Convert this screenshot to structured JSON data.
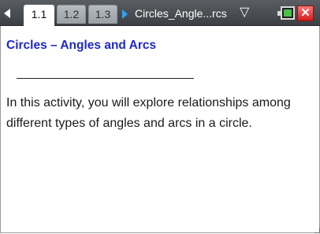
{
  "toolbar": {
    "tabs": [
      {
        "label": "1.1",
        "active": true
      },
      {
        "label": "1.2",
        "active": false
      },
      {
        "label": "1.3",
        "active": false
      }
    ],
    "document_title": "Circles_Angle...rcs",
    "chevron_glyph": "▽",
    "close_glyph": "✕",
    "icons": [
      "left-arrow-icon",
      "right-arrow-icon",
      "chevron-down-icon",
      "battery-icon",
      "close-icon"
    ]
  },
  "page": {
    "heading": "Circles – Angles and Arcs",
    "body": "In this activity, you will explore relationships among different types of angles and arcs in a circle."
  },
  "colors": {
    "heading": "#1f28c9",
    "toolbar_bg": "#4a4e52",
    "tab_active": "#ffffff",
    "tab_inactive": "#a9aeb3",
    "nav_arrow": "#2aa3ff",
    "close": "#e03a3a"
  }
}
